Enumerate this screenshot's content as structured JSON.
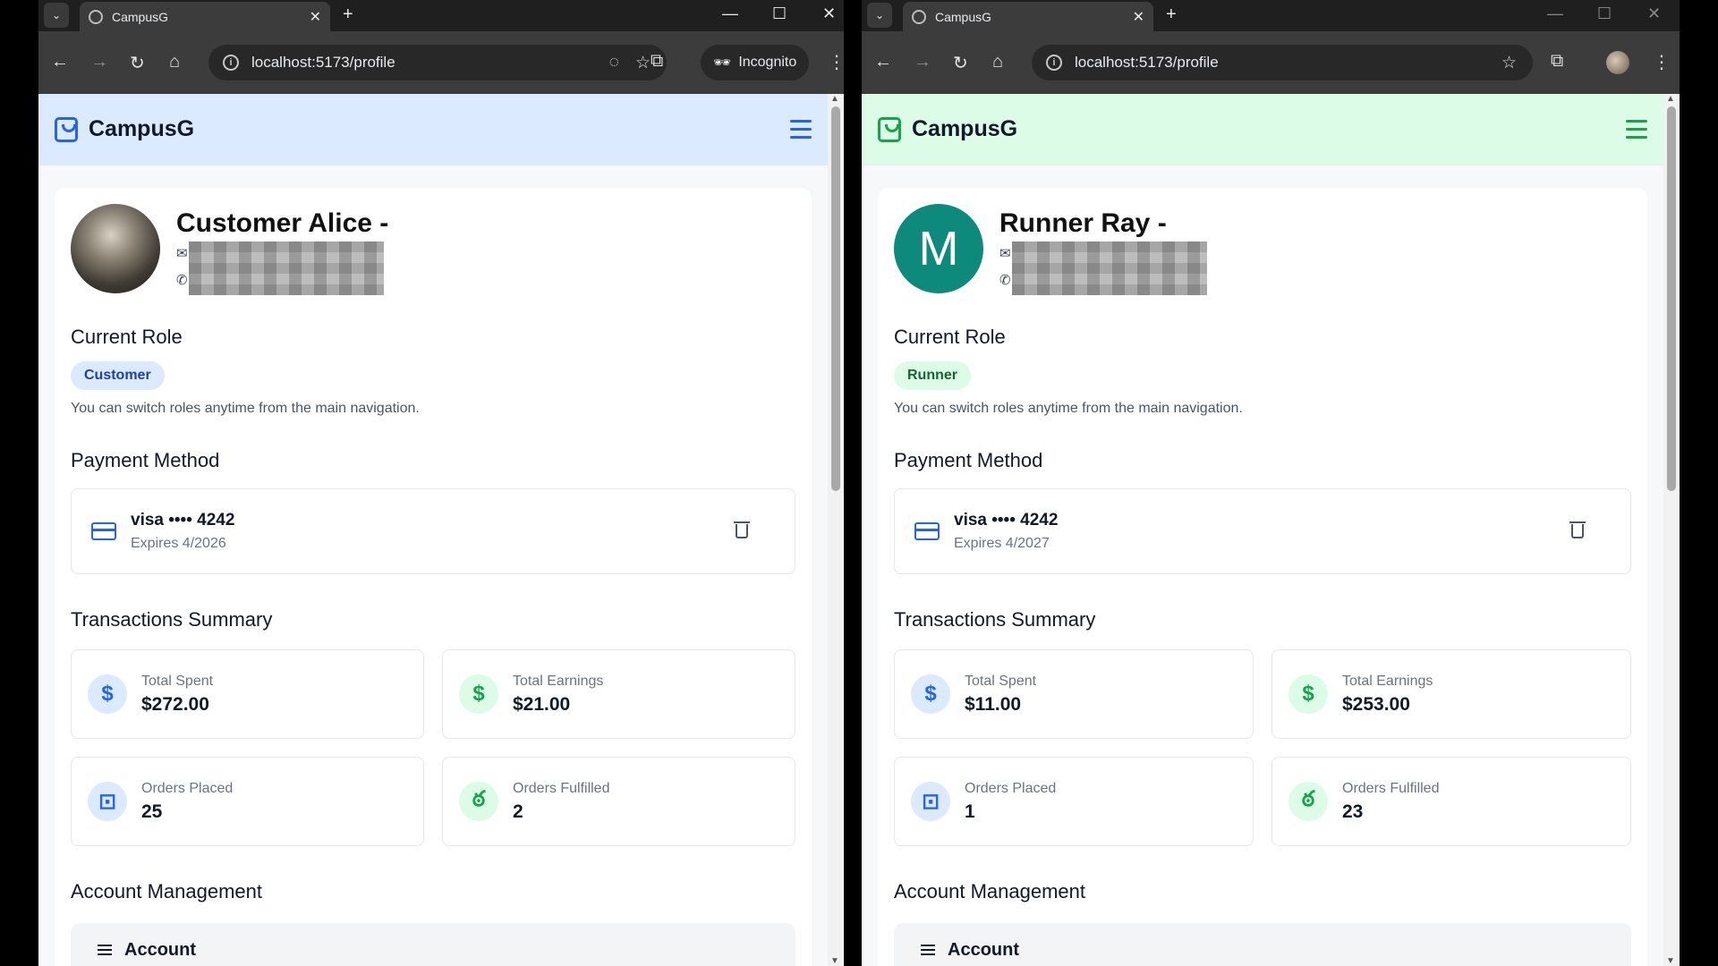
{
  "left": {
    "browser": {
      "tab_title": "CampusG",
      "url": "localhost:5173/profile",
      "incognito_label": "Incognito"
    },
    "app": {
      "brand": "CampusG",
      "header_color": "#dbeafe",
      "accent": "#2563eb"
    },
    "profile": {
      "name": "Customer Alice -",
      "avatar_letter": ""
    },
    "role": {
      "title": "Current Role",
      "badge": "Customer",
      "badge_bg": "#dbeafe",
      "badge_fg": "#1e40af",
      "note": "You can switch roles anytime from the main navigation."
    },
    "payment": {
      "title": "Payment Method",
      "card": "visa •••• 4242",
      "expires": "Expires 4/2026"
    },
    "transactions": {
      "title": "Transactions Summary",
      "stats": [
        {
          "label": "Total Spent",
          "value": "$272.00",
          "icon": "dollar-icon"
        },
        {
          "label": "Total Earnings",
          "value": "$21.00",
          "icon": "dollar-icon"
        },
        {
          "label": "Orders Placed",
          "value": "25",
          "icon": "shopping-bag-icon"
        },
        {
          "label": "Orders Fulfilled",
          "value": "2",
          "icon": "bike-icon"
        }
      ]
    },
    "account": {
      "title": "Account Management",
      "row_label": "Account"
    }
  },
  "right": {
    "browser": {
      "tab_title": "CampusG",
      "url": "localhost:5173/profile"
    },
    "app": {
      "brand": "CampusG",
      "header_color": "#dcfce7",
      "accent": "#16a34a"
    },
    "profile": {
      "name": "Runner Ray -",
      "avatar_letter": "M"
    },
    "role": {
      "title": "Current Role",
      "badge": "Runner",
      "badge_bg": "#dcfce7",
      "badge_fg": "#166534",
      "note": "You can switch roles anytime from the main navigation."
    },
    "payment": {
      "title": "Payment Method",
      "card": "visa •••• 4242",
      "expires": "Expires 4/2027"
    },
    "transactions": {
      "title": "Transactions Summary",
      "stats": [
        {
          "label": "Total Spent",
          "value": "$11.00",
          "icon": "dollar-icon"
        },
        {
          "label": "Total Earnings",
          "value": "$253.00",
          "icon": "dollar-icon"
        },
        {
          "label": "Orders Placed",
          "value": "1",
          "icon": "shopping-bag-icon"
        },
        {
          "label": "Orders Fulfilled",
          "value": "23",
          "icon": "bike-icon"
        }
      ]
    },
    "account": {
      "title": "Account Management",
      "row_label": "Account"
    }
  }
}
